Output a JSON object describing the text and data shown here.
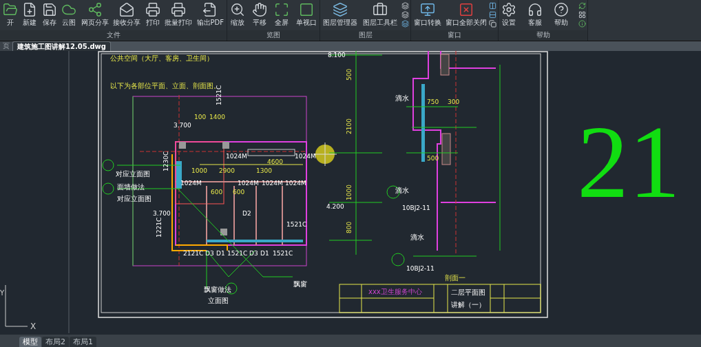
{
  "toolbar": {
    "groups": [
      {
        "label": "文件",
        "buttons": [
          {
            "label": "开"
          },
          {
            "label": "新建"
          },
          {
            "label": "保存"
          },
          {
            "label": "云图"
          },
          {
            "label": "网页分享"
          },
          {
            "label": "接收分享"
          },
          {
            "label": "打印"
          },
          {
            "label": "批量打印"
          },
          {
            "label": "输出PDF"
          }
        ]
      },
      {
        "label": "览图",
        "buttons": [
          {
            "label": "缩放"
          },
          {
            "label": "平移"
          },
          {
            "label": "全屏"
          },
          {
            "label": "单视口"
          }
        ]
      },
      {
        "label": "图层",
        "buttons": [
          {
            "label": "图层管理器"
          },
          {
            "label": "图层工具栏"
          }
        ]
      },
      {
        "label": "窗口",
        "buttons": [
          {
            "label": "窗口转换"
          },
          {
            "label": "窗口全部关闭"
          }
        ]
      },
      {
        "label": "帮助",
        "buttons": [
          {
            "label": "设置"
          },
          {
            "label": "客服"
          },
          {
            "label": "帮助"
          }
        ]
      }
    ]
  },
  "file_tabs": [
    {
      "label": "页",
      "selected": false
    },
    {
      "label": "建筑施工图讲解12.05.dwg",
      "selected": true
    }
  ],
  "drawing": {
    "page_number": "21",
    "labels": [
      {
        "text": "公共空间（大厅、客房、卫生间）"
      },
      {
        "text": "以下为各部位平面、立面、剖面图。"
      },
      {
        "text": "1521C"
      },
      {
        "text": "3.700"
      },
      {
        "text": "1024M"
      },
      {
        "text": "1024M"
      },
      {
        "text": "1230C"
      },
      {
        "text": "1024M"
      },
      {
        "text": "1024M"
      },
      {
        "text": "1024M"
      },
      {
        "text": "1024M"
      },
      {
        "text": "对应立面图"
      },
      {
        "text": "面墙做法"
      },
      {
        "text": "对应立面图"
      },
      {
        "text": "3.700"
      },
      {
        "text": "1221C"
      },
      {
        "text": "1521C"
      },
      {
        "text": "2121C"
      },
      {
        "text": "D3"
      },
      {
        "text": "D1"
      },
      {
        "text": "1521C"
      },
      {
        "text": "D3"
      },
      {
        "text": "D1"
      },
      {
        "text": "1521C"
      },
      {
        "text": "飘窗"
      },
      {
        "text": "飘窗做法"
      },
      {
        "text": "立面图"
      },
      {
        "text": "8.100"
      },
      {
        "text": "500"
      },
      {
        "text": "2100"
      },
      {
        "text": "4.200"
      },
      {
        "text": "1000"
      },
      {
        "text": "800"
      },
      {
        "text": "剖面一"
      },
      {
        "text": "xxx卫生服务中心"
      },
      {
        "text": "二层平面图"
      },
      {
        "text": "讲解（一）"
      },
      {
        "text": "滴水"
      },
      {
        "text": "10BJ2-11"
      },
      {
        "text": "10BJ2-11"
      },
      {
        "text": "100"
      },
      {
        "text": "1400"
      },
      {
        "text": "4600"
      },
      {
        "text": "1000"
      },
      {
        "text": "2900"
      },
      {
        "text": "1300"
      },
      {
        "text": "600"
      },
      {
        "text": "600"
      },
      {
        "text": "D2"
      },
      {
        "text": "750"
      },
      {
        "text": "300"
      },
      {
        "text": "500"
      },
      {
        "text": "滴水"
      },
      {
        "text": "滴水"
      }
    ]
  },
  "ucs": {
    "x_label": "X",
    "y_label": "Y"
  },
  "layout_tabs": [
    {
      "label": "模型",
      "selected": true
    },
    {
      "label": "布局2",
      "selected": false
    },
    {
      "label": "布局1",
      "selected": false
    }
  ]
}
